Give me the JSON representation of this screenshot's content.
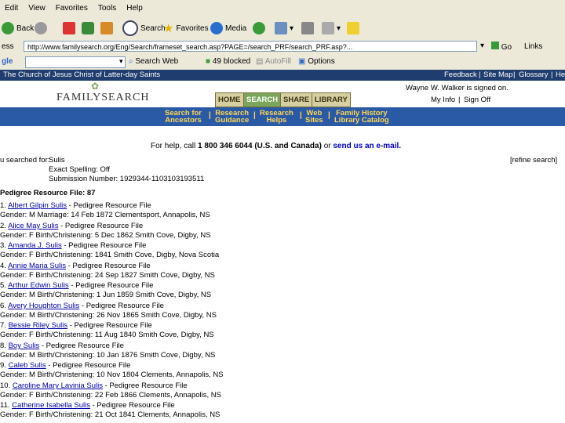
{
  "menu": [
    "Edit",
    "View",
    "Favorites",
    "Tools",
    "Help"
  ],
  "toolbar": {
    "back": "Back",
    "search": "Search",
    "favorites": "Favorites",
    "media": "Media"
  },
  "address": {
    "label": "ess",
    "url": "http://www.familysearch.org/Eng/Search/frameset_search.asp?PAGE=/search_PRF/search_PRF.asp?...",
    "go": "Go",
    "links": "Links"
  },
  "google": {
    "label": "gle",
    "search_web": "Search Web",
    "blocked": "49 blocked",
    "autofill": "AutoFill",
    "options": "Options"
  },
  "site": {
    "church": "The Church of Jesus Christ of Latter-day Saints",
    "feedback": "Feedback",
    "sitemap": "Site Map",
    "glossary": "Glossary",
    "help": "He"
  },
  "header": {
    "logo": "FAMILYSEARCH",
    "tabs": [
      "HOME",
      "SEARCH",
      "SHARE",
      "LIBRARY"
    ],
    "signed_on": "Wayne W. Walker is signed on.",
    "my_info": "My Info",
    "sign_off": "Sign Off"
  },
  "subnav": [
    [
      "Search for",
      "Ancestors"
    ],
    [
      "Research",
      "Guidance"
    ],
    [
      "Research",
      "Helps"
    ],
    [
      "Web",
      "Sites"
    ],
    [
      "Family History",
      "Library Catalog"
    ]
  ],
  "help": {
    "pre": "For help, call",
    "phone": "1 800 346 6044",
    "region": "(U.S. and Canada)",
    "or": "or",
    "link": "send us an e-mail."
  },
  "criteria": {
    "label": "u searched for:",
    "name": "Sulis",
    "exact": "Exact Spelling: Off",
    "submission": "Submission Number: 1929344-1103103193511",
    "refine": "[refine search]"
  },
  "results": {
    "heading": "Pedigree Resource File: 87",
    "items": [
      {
        "n": "1.",
        "name": "Albert Gilpin Sulis",
        "src": " - Pedigree Resource File",
        "detail": "Gender: M Marriage: 14 Feb 1872 Clementsport, Annapolis, NS"
      },
      {
        "n": "2.",
        "name": "Alice May Sulis",
        "src": " - Pedigree Resource File",
        "detail": "Gender: F Birth/Christening: 5 Dec 1862 Smith Cove, Digby, NS"
      },
      {
        "n": "3.",
        "name": "Amanda J. Sulis",
        "src": " - Pedigree Resource File",
        "detail": "Gender: F Birth/Christening: 1841 Smith Cove, Digby, Nova Scotia"
      },
      {
        "n": "4.",
        "name": "Annie Maria Sulis",
        "src": " - Pedigree Resource File",
        "detail": "Gender: F Birth/Christening: 24 Sep 1827 Smith Cove, Digby, NS"
      },
      {
        "n": "5.",
        "name": "Arthur Edwin Sulis",
        "src": " - Pedigree Resource File",
        "detail": "Gender: M Birth/Christening: 1 Jun 1859 Smith Cove, Digby, NS"
      },
      {
        "n": "6.",
        "name": "Avery Houghton Sulis",
        "src": " - Pedigree Resource File",
        "detail": "Gender: M Birth/Christening: 26 Nov 1865 Smith Cove, Digby, NS"
      },
      {
        "n": "7.",
        "name": "Bessie Riley Sulis",
        "src": " - Pedigree Resource File",
        "detail": "Gender: F Birth/Christening: 11 Aug 1840 Smith Cove, Digby, NS"
      },
      {
        "n": "8.",
        "name": "Boy Sulis",
        "src": " - Pedigree Resource File",
        "detail": "Gender: M Birth/Christening: 10 Jan 1876 Smith Cove, Digby, NS"
      },
      {
        "n": "9.",
        "name": "Caleb Sulis",
        "src": " - Pedigree Resource File",
        "detail": "Gender: M Birth/Christening: 10 Nov 1804 Clements, Annapolis, NS"
      },
      {
        "n": "10.",
        "name": "Caroline Mary Lavinia Sulis",
        "src": " - Pedigree Resource File",
        "detail": "Gender: F Birth/Christening: 22 Feb 1866 Clements, Annapolis, NS"
      },
      {
        "n": "11.",
        "name": "Catherine Isabella Sulis",
        "src": " - Pedigree Resource File",
        "detail": "Gender: F Birth/Christening: 21 Oct 1841 Clements, Annapolis, NS"
      }
    ]
  },
  "colors": {
    "site_bar": "#1f3d6e",
    "subnav": "#2a5aa6",
    "subnav_text": "#ffd750",
    "link": "#0000a8"
  }
}
